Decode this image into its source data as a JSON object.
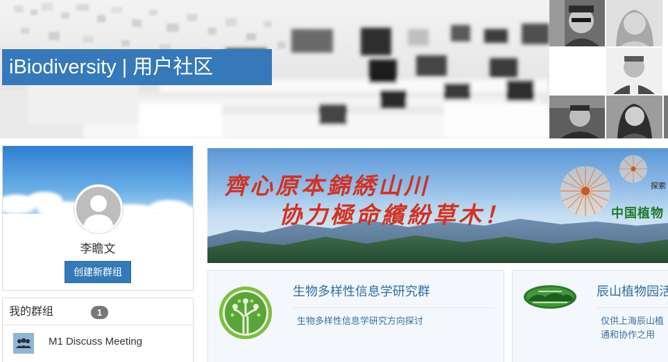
{
  "header": {
    "site_title": "iBiodiversity | 用户社区",
    "member_photos": [
      "member-photo",
      "member-photo",
      "member-photo",
      "member-photo",
      "member-photo",
      "member-photo"
    ]
  },
  "profile": {
    "user_name": "李瞻文",
    "create_group_label": "创建新群组"
  },
  "my_groups": {
    "heading": "我的群组",
    "count": "1",
    "items": [
      {
        "name": "M1 Discuss Meeting",
        "icon": "people-group-icon"
      }
    ]
  },
  "featured_banner": {
    "slogan_line_1": "齊心原本錦綉山川",
    "slogan_line_2": "协力極命繽紛草木！",
    "tag": "探索",
    "org": "中国植物"
  },
  "group_cards": [
    {
      "title": "生物多样性信息学研究群",
      "description": "生物多样性信息学研究方向探讨",
      "icon": "tree-logo-icon"
    },
    {
      "title": "辰山植物园活",
      "description": "仅供上海辰山植\n通和协作之用",
      "icon": "garden-logo-icon"
    }
  ],
  "colors": {
    "title_bar": "#3579bb",
    "button": "#3479b9",
    "badge": "#777777",
    "slogan": "#d4311f",
    "link": "#2e6da4"
  }
}
